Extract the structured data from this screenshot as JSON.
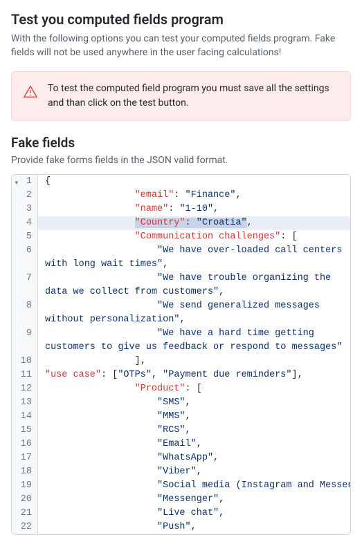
{
  "header": {
    "title": "Test you computed fields program",
    "subtitle": "With the following options you can test your computed fields program. Fake fields will not be used anywhere in the user facing calculations!"
  },
  "alert": {
    "text": "To test the computed field program you must save all the settings and than click on the test button."
  },
  "section": {
    "title": "Fake fields",
    "subtitle": "Provide fake forms fields in the JSON valid format."
  },
  "editor": {
    "highlighted_line": 4,
    "lines": [
      {
        "n": 1,
        "fold": true,
        "segs": [
          {
            "t": "punc",
            "v": "{"
          }
        ]
      },
      {
        "n": 2,
        "segs": [
          {
            "t": "ind",
            "v": "                "
          },
          {
            "t": "key",
            "v": "\"email\""
          },
          {
            "t": "punc",
            "v": ": "
          },
          {
            "t": "str",
            "v": "\"Finance\""
          },
          {
            "t": "punc",
            "v": ","
          }
        ]
      },
      {
        "n": 3,
        "segs": [
          {
            "t": "ind",
            "v": "                "
          },
          {
            "t": "key",
            "v": "\"name\""
          },
          {
            "t": "punc",
            "v": ": "
          },
          {
            "t": "str",
            "v": "\"1-10\""
          },
          {
            "t": "punc",
            "v": ","
          }
        ]
      },
      {
        "n": 4,
        "segs": [
          {
            "t": "ind",
            "v": "                "
          },
          {
            "t": "key",
            "v": "\"Country\"",
            "hl": true
          },
          {
            "t": "punc",
            "v": ": ",
            "hl": true
          },
          {
            "t": "str",
            "v": "\"Croatia\"",
            "hl": true
          },
          {
            "t": "punc",
            "v": ","
          }
        ]
      },
      {
        "n": 5,
        "segs": [
          {
            "t": "ind",
            "v": "                "
          },
          {
            "t": "key",
            "v": "\"Communication challenges\""
          },
          {
            "t": "punc",
            "v": ": ["
          }
        ]
      },
      {
        "n": 6,
        "segs": [
          {
            "t": "ind",
            "v": "                    "
          },
          {
            "t": "str",
            "v": "\"We have over-loaded call centers with long wait times\""
          },
          {
            "t": "punc",
            "v": ","
          }
        ],
        "wrap": true
      },
      {
        "n": 7,
        "segs": [
          {
            "t": "ind",
            "v": "                    "
          },
          {
            "t": "str",
            "v": "\"We have trouble organizing the data we collect from customers\""
          },
          {
            "t": "punc",
            "v": ","
          }
        ],
        "wrap": true
      },
      {
        "n": 8,
        "segs": [
          {
            "t": "ind",
            "v": "                    "
          },
          {
            "t": "str",
            "v": "\"We send generalized messages without personalization\""
          },
          {
            "t": "punc",
            "v": ","
          }
        ],
        "wrap": true
      },
      {
        "n": 9,
        "segs": [
          {
            "t": "ind",
            "v": "                    "
          },
          {
            "t": "str",
            "v": "\"We have a hard time getting customers to give us feedback or respond to messages\""
          }
        ],
        "wrap": true
      },
      {
        "n": 10,
        "segs": [
          {
            "t": "ind",
            "v": "                "
          },
          {
            "t": "punc",
            "v": "],"
          }
        ]
      },
      {
        "n": 11,
        "segs": [
          {
            "t": "key",
            "v": "\"use case\""
          },
          {
            "t": "punc",
            "v": ": ["
          },
          {
            "t": "str",
            "v": "\"OTPs\""
          },
          {
            "t": "punc",
            "v": ", "
          },
          {
            "t": "str",
            "v": "\"Payment due reminders\""
          },
          {
            "t": "punc",
            "v": "],"
          }
        ]
      },
      {
        "n": 12,
        "segs": [
          {
            "t": "ind",
            "v": "                "
          },
          {
            "t": "key",
            "v": "\"Product\""
          },
          {
            "t": "punc",
            "v": ": ["
          }
        ]
      },
      {
        "n": 13,
        "segs": [
          {
            "t": "ind",
            "v": "                    "
          },
          {
            "t": "str",
            "v": "\"SMS\""
          },
          {
            "t": "punc",
            "v": ","
          }
        ]
      },
      {
        "n": 14,
        "segs": [
          {
            "t": "ind",
            "v": "                    "
          },
          {
            "t": "str",
            "v": "\"MMS\""
          },
          {
            "t": "punc",
            "v": ","
          }
        ]
      },
      {
        "n": 15,
        "segs": [
          {
            "t": "ind",
            "v": "                    "
          },
          {
            "t": "str",
            "v": "\"RCS\""
          },
          {
            "t": "punc",
            "v": ","
          }
        ]
      },
      {
        "n": 16,
        "segs": [
          {
            "t": "ind",
            "v": "                    "
          },
          {
            "t": "str",
            "v": "\"Email\""
          },
          {
            "t": "punc",
            "v": ","
          }
        ]
      },
      {
        "n": 17,
        "segs": [
          {
            "t": "ind",
            "v": "                    "
          },
          {
            "t": "str",
            "v": "\"WhatsApp\""
          },
          {
            "t": "punc",
            "v": ","
          }
        ]
      },
      {
        "n": 18,
        "segs": [
          {
            "t": "ind",
            "v": "                    "
          },
          {
            "t": "str",
            "v": "\"Viber\""
          },
          {
            "t": "punc",
            "v": ","
          }
        ]
      },
      {
        "n": 19,
        "segs": [
          {
            "t": "ind",
            "v": "                    "
          },
          {
            "t": "str",
            "v": "\"Social media (Instagram and Messenger)\""
          },
          {
            "t": "punc",
            "v": ","
          }
        ]
      },
      {
        "n": 20,
        "segs": [
          {
            "t": "ind",
            "v": "                    "
          },
          {
            "t": "str",
            "v": "\"Messenger\""
          },
          {
            "t": "punc",
            "v": ","
          }
        ]
      },
      {
        "n": 21,
        "segs": [
          {
            "t": "ind",
            "v": "                    "
          },
          {
            "t": "str",
            "v": "\"Live chat\""
          },
          {
            "t": "punc",
            "v": ","
          }
        ]
      },
      {
        "n": 22,
        "segs": [
          {
            "t": "ind",
            "v": "                    "
          },
          {
            "t": "str",
            "v": "\"Push\""
          },
          {
            "t": "punc",
            "v": ","
          }
        ]
      }
    ]
  }
}
